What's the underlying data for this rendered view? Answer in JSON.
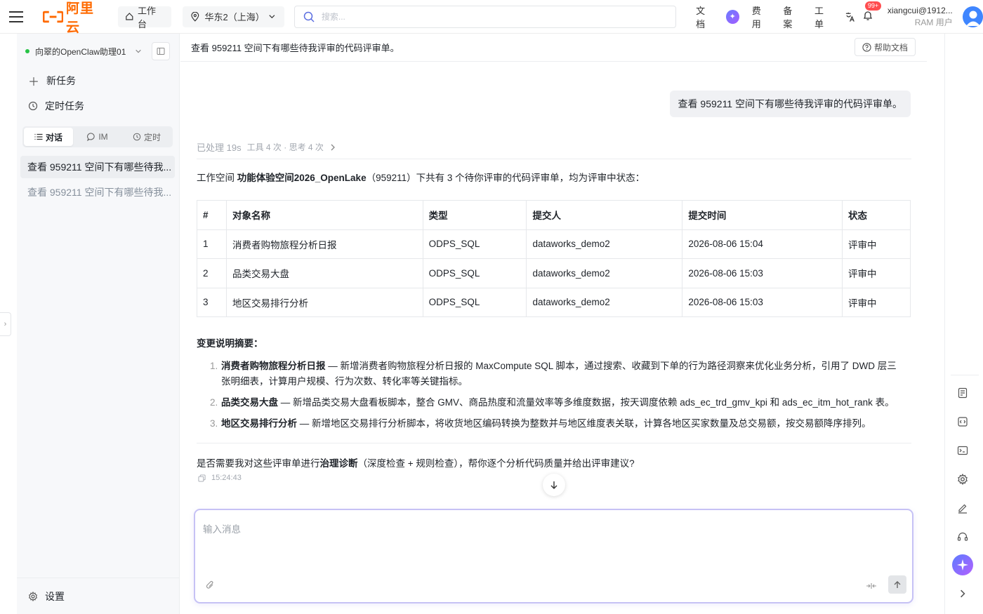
{
  "topbar": {
    "brand": "阿里云",
    "workbench": "工作台",
    "region": "华东2（上海）",
    "search_placeholder": "搜索...",
    "links": [
      "文档",
      "费用",
      "备案",
      "工单"
    ],
    "notif_badge": "99+",
    "user_name": "xiangcui@1912...",
    "user_role": "RAM 用户",
    "brand_color": "#ff6a00"
  },
  "sidebar": {
    "agent_name": "向翠的OpenClaw助理01",
    "new_task": "新任务",
    "scheduled_task": "定时任务",
    "tabs": [
      "对话",
      "IM",
      "定时"
    ],
    "conversations": [
      "查看 959211 空间下有哪些待我...",
      "查看 959211 空间下有哪些待我..."
    ],
    "settings": "设置"
  },
  "main": {
    "title": "查看 959211 空间下有哪些待我评审的代码评审单。",
    "help": "帮助文档",
    "user_message": "查看 959211 空间下有哪些待我评审的代码评审单。",
    "processed": "已处理 19s",
    "processed_detail": "工具 4 次 · 思考 4 次",
    "intro_prefix": "工作空间 ",
    "intro_workspace": "功能体验空间2026_OpenLake",
    "intro_suffix": "（959211）下共有 3 个待你评审的代码评审单，均为评审中状态：",
    "table": {
      "headers": [
        "#",
        "对象名称",
        "类型",
        "提交人",
        "提交时间",
        "状态"
      ],
      "rows": [
        [
          "1",
          "消费者购物旅程分析日报",
          "ODPS_SQL",
          "dataworks_demo2",
          "2026-08-06 15:04",
          "评审中"
        ],
        [
          "2",
          "品类交易大盘",
          "ODPS_SQL",
          "dataworks_demo2",
          "2026-08-06 15:03",
          "评审中"
        ],
        [
          "3",
          "地区交易排行分析",
          "ODPS_SQL",
          "dataworks_demo2",
          "2026-08-06 15:03",
          "评审中"
        ]
      ]
    },
    "summary_title": "变更说明摘要：",
    "summary": [
      {
        "num": "1.",
        "name": "消费者购物旅程分析日报",
        "desc": " — 新增消费者购物旅程分析日报的 MaxCompute SQL 脚本，通过搜索、收藏到下单的行为路径洞察来优化业务分析，引用了 DWD 层三张明细表，计算用户规模、行为次数、转化率等关键指标。"
      },
      {
        "num": "2.",
        "name": "品类交易大盘",
        "desc": " — 新增品类交易大盘看板脚本，整合 GMV、商品热度和流量效率等多维度数据，按天调度依赖 ads_ec_trd_gmv_kpi 和 ads_ec_itm_hot_rank 表。"
      },
      {
        "num": "3.",
        "name": "地区交易排行分析",
        "desc": " — 新增地区交易排行分析脚本，将收货地区编码转换为整数并与地区维度表关联，计算各地区买家数量及总交易额，按交易额降序排列。"
      }
    ],
    "question_prefix": "是否需要我对这些评审单进行",
    "question_bold": "治理诊断",
    "question_suffix": "（深度检查 + 规则检查），帮你逐个分析代码质量并给出评审建议?",
    "timestamp": "15:24:43",
    "input_placeholder": "输入消息"
  }
}
